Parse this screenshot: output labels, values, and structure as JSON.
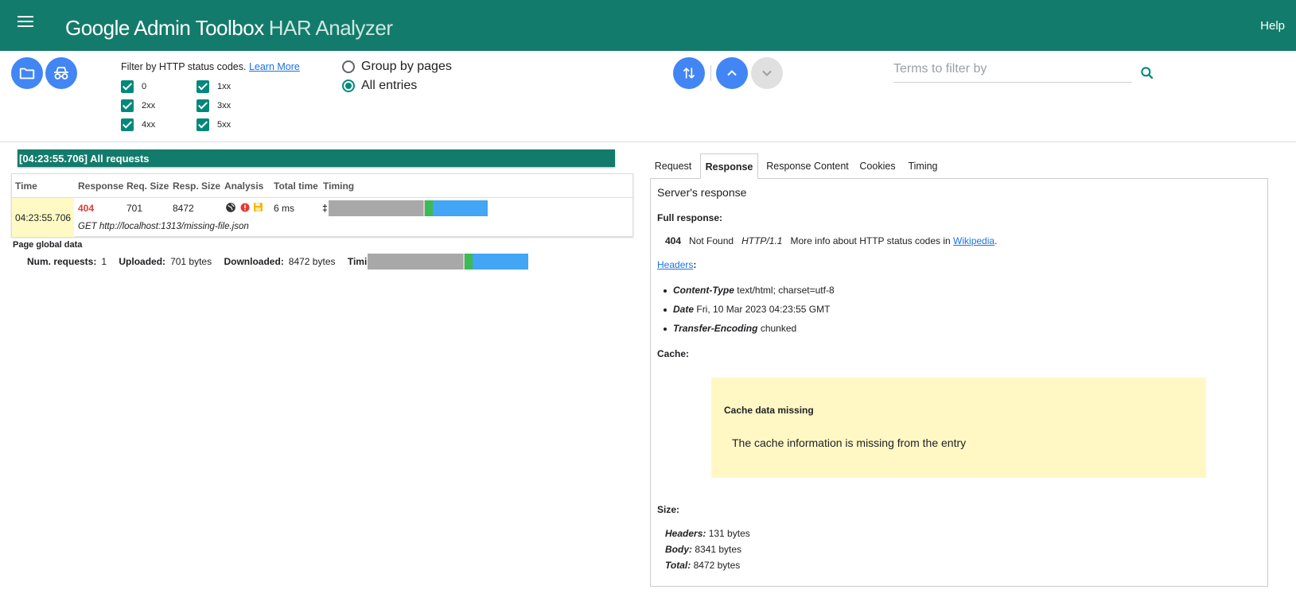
{
  "header": {
    "menu_icon": "menu-icon",
    "brand": "Google Admin Toolbox",
    "sub": "HAR Analyzer",
    "help": "Help"
  },
  "toolbar": {
    "open_icon": "folder-icon",
    "anon_icon": "incognito-icon",
    "filter_label": "Filter by HTTP status codes.",
    "learn_more": "Learn More",
    "codes": [
      "0",
      "1xx",
      "2xx",
      "3xx",
      "4xx",
      "5xx"
    ],
    "group_by_pages": "Group by pages",
    "all_entries": "All entries",
    "search_placeholder": "Terms to filter by"
  },
  "requests": {
    "title": "[04:23:55.706] All requests",
    "headers": [
      "Time",
      "Response",
      "Req. Size",
      "Resp. Size",
      "Analysis",
      "Total time",
      "Timing"
    ],
    "row": {
      "time": "04:23:55.706",
      "response": "404",
      "req_size": "701",
      "resp_size": "8472",
      "total_time": "6 ms",
      "timing_marker": "‡",
      "url": "GET http://localhost:1313/missing-file.json"
    }
  },
  "global": {
    "title": "Page global data",
    "num_label": "Num. requests:",
    "num": "1",
    "up_label": "Uploaded:",
    "up": "701 bytes",
    "down_label": "Downloaded:",
    "down": "8472 bytes",
    "timings_label": "Timings:",
    "timings_marker": "‡"
  },
  "tabs": [
    "Request",
    "Response",
    "Response Content",
    "Cookies",
    "Timing"
  ],
  "response": {
    "heading": "Server's response",
    "full_label": "Full response:",
    "status": "404",
    "status_text": "Not Found",
    "protocol": "HTTP/1.1",
    "info": "More info about HTTP status codes in",
    "wiki": "Wikipedia",
    ".": ".",
    "headers_link": "Headers",
    "colon": ":",
    "h": [
      {
        "k": "Content-Type",
        "v": "text/html; charset=utf-8"
      },
      {
        "k": "Date",
        "v": "Fri, 10 Mar 2023 04:23:55 GMT"
      },
      {
        "k": "Transfer-Encoding",
        "v": "chunked"
      }
    ],
    "cache_label": "Cache:",
    "cache_title": "Cache data missing",
    "cache_msg": "The cache information is missing from the entry",
    "size_label": "Size:",
    "sz": [
      {
        "k": "Headers:",
        "v": "131 bytes"
      },
      {
        "k": "Body:",
        "v": "8341 bytes"
      },
      {
        "k": "Total:",
        "v": "8472 bytes"
      }
    ]
  },
  "colors": {
    "header": "#137b6b",
    "accent": "#00897b",
    "button": "#4285f4",
    "error": "#e53935"
  }
}
